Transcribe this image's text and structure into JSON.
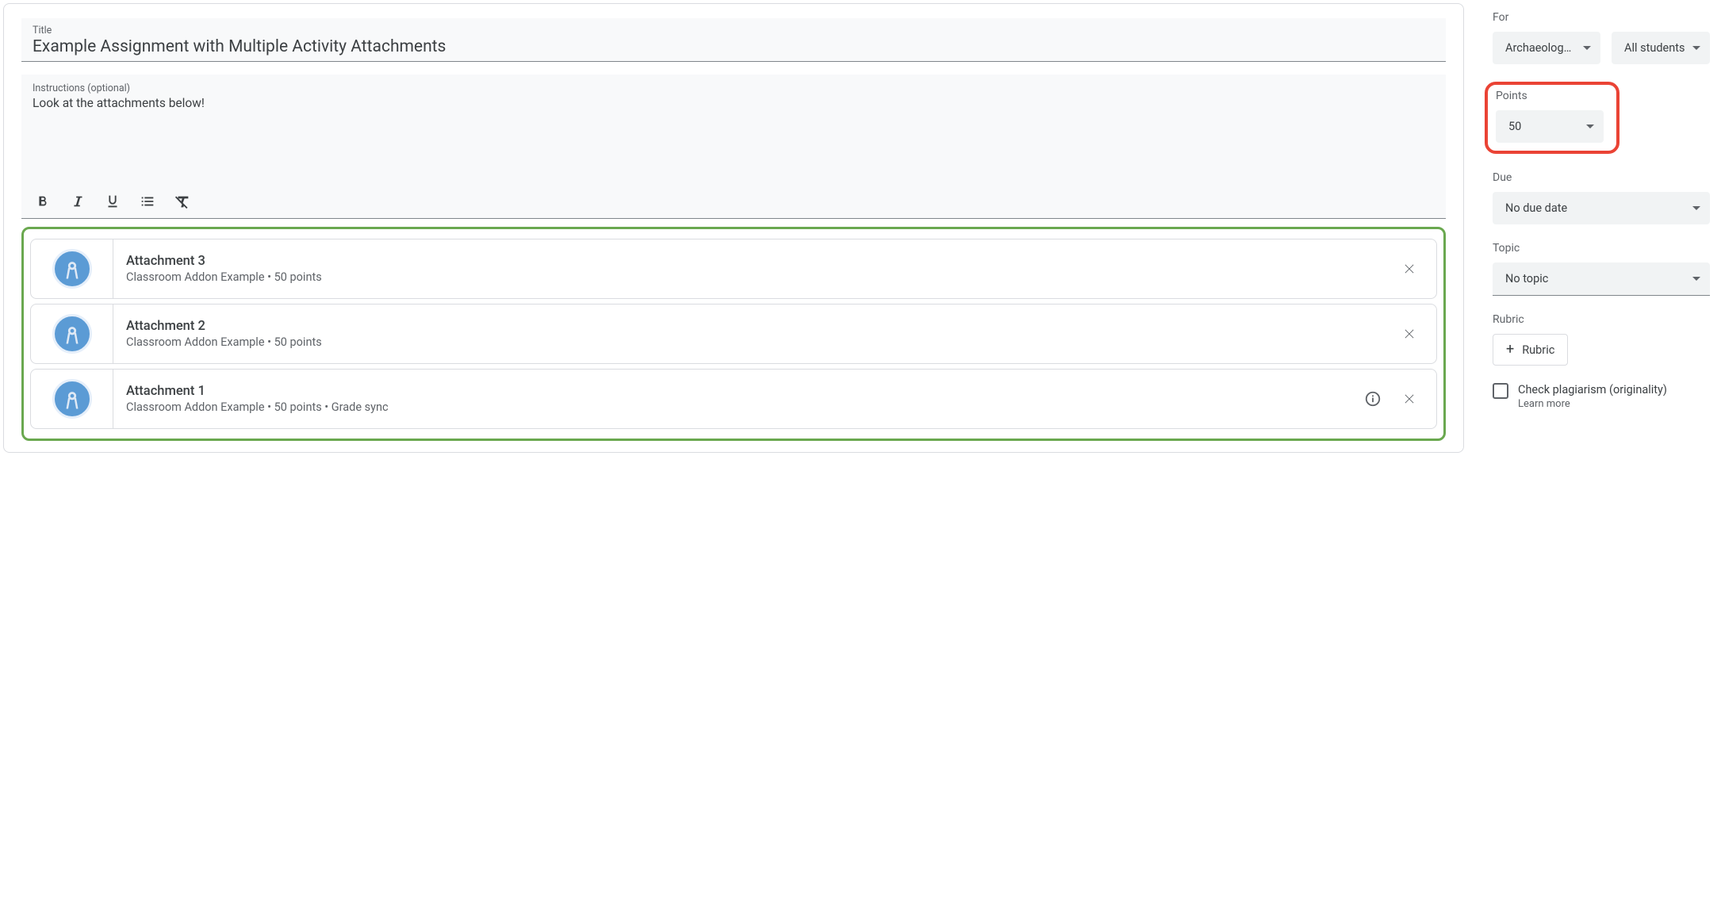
{
  "form": {
    "title_label": "Title",
    "title_value": "Example Assignment with Multiple Activity Attachments",
    "instructions_label": "Instructions (optional)",
    "instructions_value": "Look at the attachments below!"
  },
  "attachments": [
    {
      "title": "Attachment 3",
      "subtitle": "Classroom Addon Example • 50 points",
      "has_info": false
    },
    {
      "title": "Attachment 2",
      "subtitle": "Classroom Addon Example • 50 points",
      "has_info": false
    },
    {
      "title": "Attachment 1",
      "subtitle": "Classroom Addon Example • 50 points • Grade sync",
      "has_info": true
    }
  ],
  "sidebar": {
    "for_label": "For",
    "for_class": "Archaeology …",
    "for_students": "All students",
    "points_label": "Points",
    "points_value": "50",
    "due_label": "Due",
    "due_value": "No due date",
    "topic_label": "Topic",
    "topic_value": "No topic",
    "rubric_label": "Rubric",
    "rubric_button": "Rubric",
    "plagiarism_label": "Check plagiarism (originality)",
    "learn_more": "Learn more"
  }
}
